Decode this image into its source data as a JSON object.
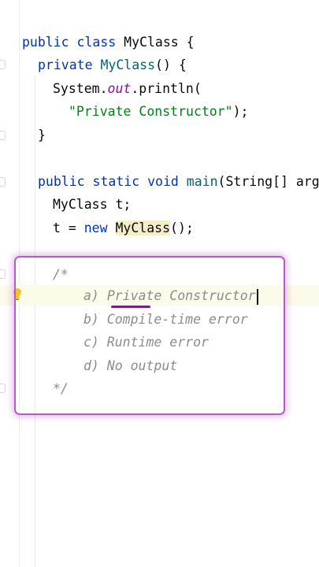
{
  "code": {
    "class_decl": {
      "kw1": "public",
      "kw2": "class",
      "name": "MyClass",
      "brace": " {"
    },
    "constructor_decl": {
      "kw": "private",
      "name": "MyClass",
      "rest": "() {"
    },
    "println_call": {
      "obj": "System.",
      "field": "out",
      "method": ".println("
    },
    "println_arg": {
      "str": "\"Private Constructor\"",
      "rest": ");"
    },
    "constructor_close": "}",
    "main_decl": {
      "kw1": "public",
      "kw2": "static",
      "kw3": "void",
      "name": "main",
      "rest": "(String[] arg"
    },
    "var_decl": {
      "type": "MyClass",
      "var": "t",
      "rest": ";"
    },
    "assign": {
      "var": "t",
      "op": " = ",
      "kw": "new",
      "cls": "MyClass",
      "rest": "();"
    },
    "comment_open": "/*",
    "option_a_prefix": "a) ",
    "option_a_text": "Private Constructor",
    "option_b": "b) Compile-time error",
    "option_c": "c) Runtime error",
    "option_d": "d) No output",
    "comment_close": "*/"
  },
  "colors": {
    "keyword": "#0033b3",
    "method": "#00627a",
    "string": "#067d17",
    "comment": "#8c8c8c",
    "highlight_border": "#b25bc9"
  }
}
